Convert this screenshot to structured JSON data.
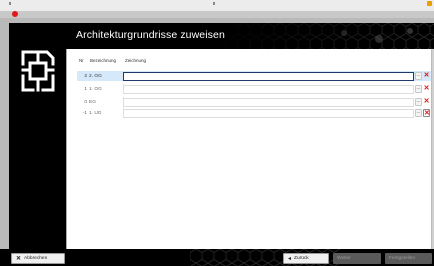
{
  "window": {
    "close_color": "#e01a1a"
  },
  "header": {
    "title": "Architekturgrundrisse zuweisen"
  },
  "table": {
    "columns": [
      "Nr",
      "Bezeichnung",
      "Zeichnung"
    ],
    "rows": [
      {
        "nr": "2",
        "bezeichnung": "2. OG",
        "zeichnung": "",
        "selected": true
      },
      {
        "nr": "1",
        "bezeichnung": "1. OG",
        "zeichnung": "",
        "selected": false
      },
      {
        "nr": "0",
        "bezeichnung": "EG",
        "zeichnung": "",
        "selected": false
      },
      {
        "nr": "-1",
        "bezeichnung": "1. UG",
        "zeichnung": "",
        "selected": false
      }
    ],
    "browse_button_label": "...",
    "remove_icon": "close-icon"
  },
  "footer": {
    "abort_label": "Abbrechen",
    "back_label": "Zurück",
    "next_label": "Weiter",
    "finish_label": "Fertigstellen"
  },
  "colors": {
    "accent": "#e01a1a",
    "selection": "#d6e9fa",
    "panel": "#000000"
  }
}
